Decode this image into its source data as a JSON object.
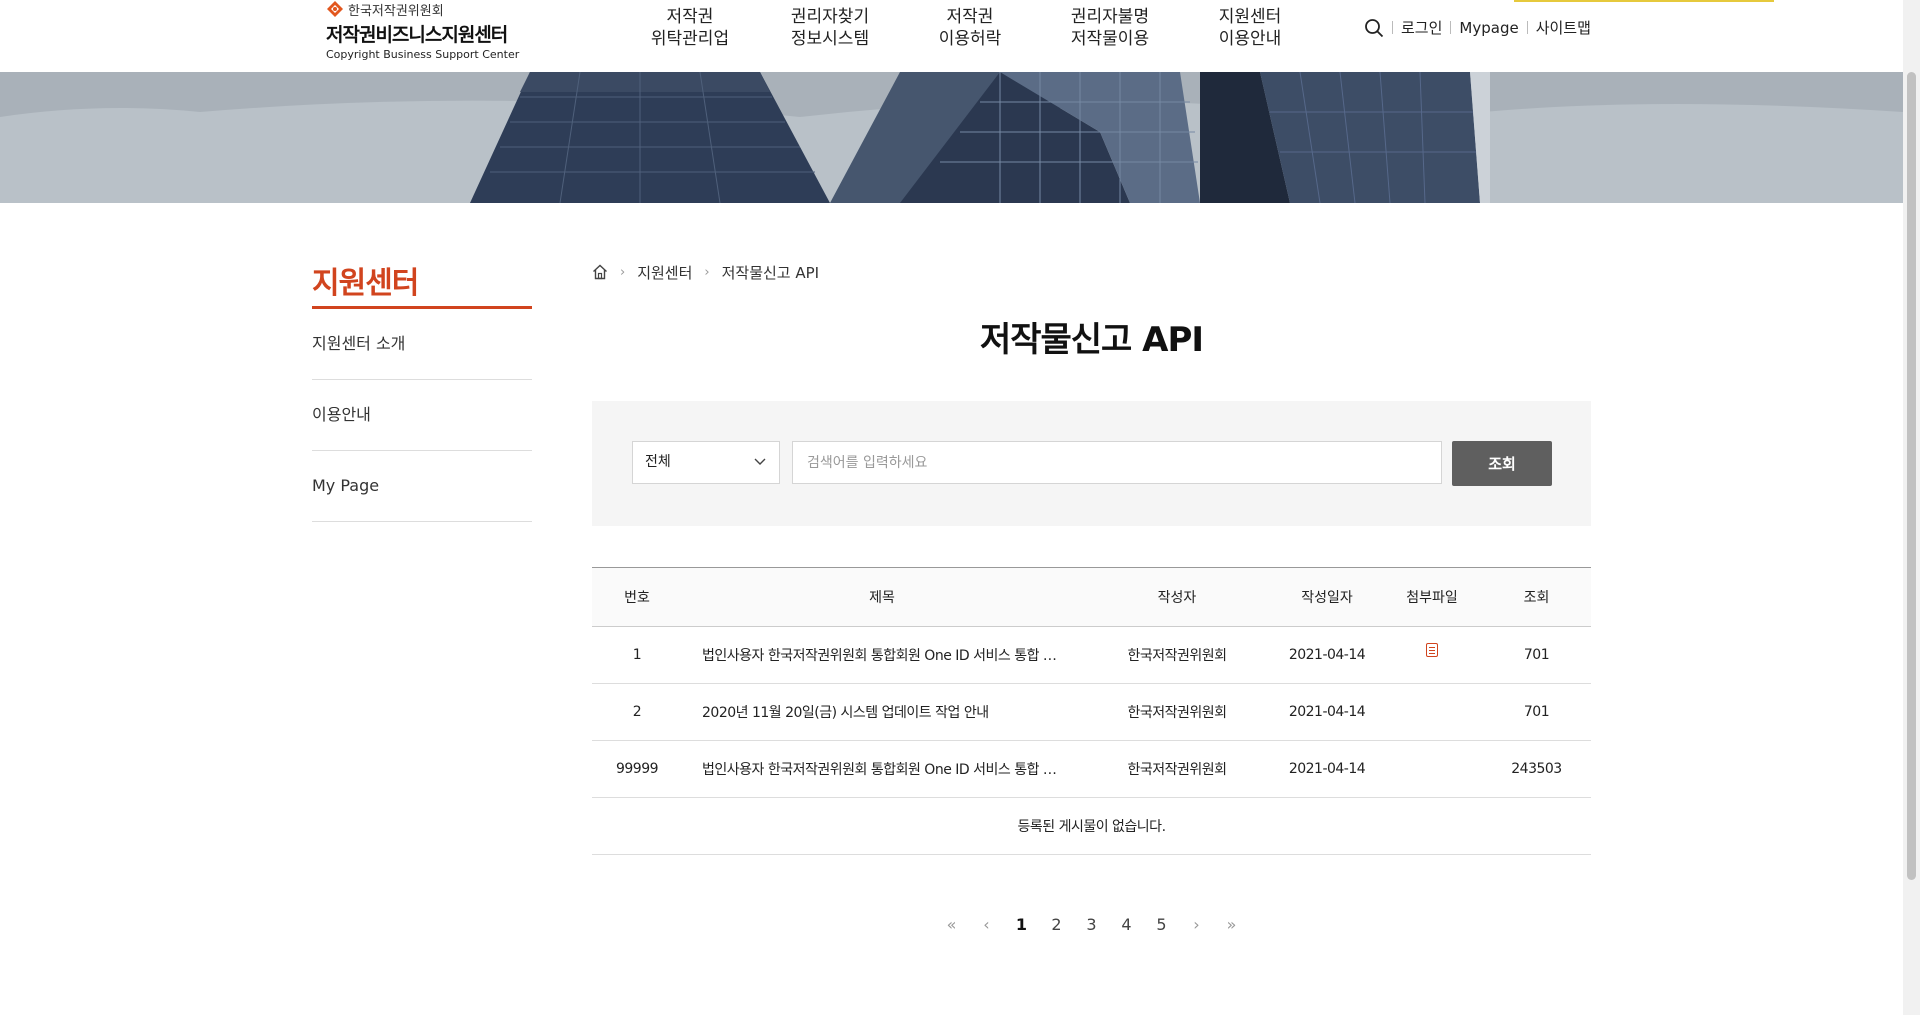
{
  "header": {
    "org_name": "한국저작권위원회",
    "site_name": "저작권비즈니스지원센터",
    "site_name_en": "Copyright Business Support Center",
    "gnb": [
      {
        "line1": "저작권",
        "line2": "위탁관리업"
      },
      {
        "line1": "권리자찾기",
        "line2": "정보시스템"
      },
      {
        "line1": "저작권",
        "line2": "이용허락"
      },
      {
        "line1": "권리자불명",
        "line2": "저작물이용"
      },
      {
        "line1": "지원센터",
        "line2": "이용안내"
      }
    ],
    "util": {
      "login": "로그인",
      "mypage": "Mypage",
      "sitemap": "사이트맵"
    },
    "search_icon": "search-icon"
  },
  "sidebar": {
    "title": "지원센터",
    "items": [
      {
        "label": "지원센터 소개"
      },
      {
        "label": "이용안내"
      },
      {
        "label": "My Page"
      }
    ]
  },
  "breadcrumb": {
    "home_icon": "home-icon",
    "level1": "지원센터",
    "level2": "저작물신고 API"
  },
  "page_title": "저작물신고 API",
  "search": {
    "select_value": "전체",
    "placeholder": "검색어를 입력하세요",
    "button_label": "조회"
  },
  "table": {
    "headers": [
      "번호",
      "제목",
      "작성자",
      "작성일자",
      "첨부파일",
      "조회"
    ],
    "rows": [
      {
        "no": "1",
        "title": "법인사용자 한국저작권위원회 통합회원 One ID 서비스 통합 …",
        "author": "한국저작권위원회",
        "date": "2021-04-14",
        "attachment": true,
        "views": "701"
      },
      {
        "no": "2",
        "title": "2020년 11월 20일(금) 시스템 업데이트 작업 안내",
        "author": "한국저작권위원회",
        "date": "2021-04-14",
        "attachment": false,
        "views": "701"
      },
      {
        "no": "99999",
        "title": "법인사용자 한국저작권위원회 통합회원 One ID 서비스 통합 …",
        "author": "한국저작권위원회",
        "date": "2021-04-14",
        "attachment": false,
        "views": "243503"
      }
    ],
    "empty_message": "등록된 게시물이 없습니다."
  },
  "pagination": {
    "first": "«",
    "prev": "‹",
    "next": "›",
    "last": "»",
    "pages": [
      "1",
      "2",
      "3",
      "4",
      "5"
    ],
    "current": "1"
  },
  "colors": {
    "accent": "#d1441e",
    "button": "#5f5f5f"
  }
}
